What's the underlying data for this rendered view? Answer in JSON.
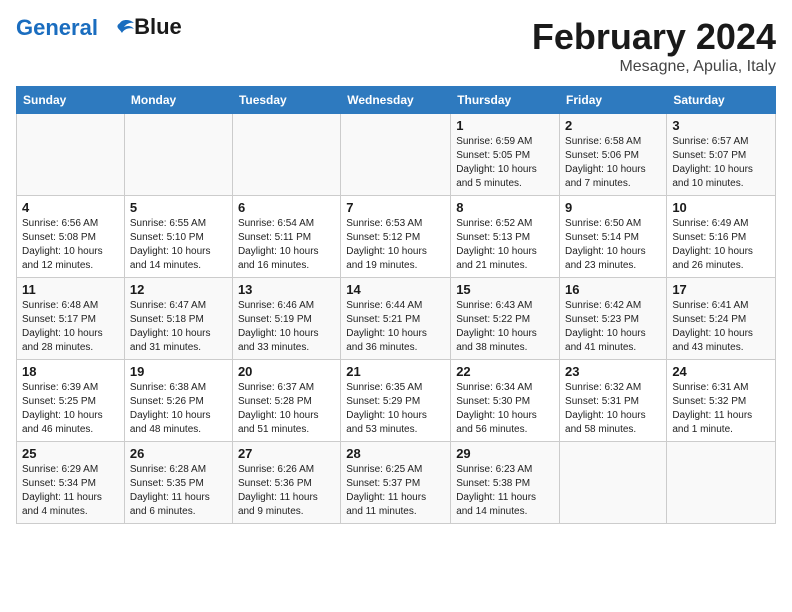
{
  "header": {
    "logo_line1": "General",
    "logo_line2": "Blue",
    "month_title": "February 2024",
    "subtitle": "Mesagne, Apulia, Italy"
  },
  "days_of_week": [
    "Sunday",
    "Monday",
    "Tuesday",
    "Wednesday",
    "Thursday",
    "Friday",
    "Saturday"
  ],
  "weeks": [
    [
      {
        "day": "",
        "detail": ""
      },
      {
        "day": "",
        "detail": ""
      },
      {
        "day": "",
        "detail": ""
      },
      {
        "day": "",
        "detail": ""
      },
      {
        "day": "1",
        "detail": "Sunrise: 6:59 AM\nSunset: 5:05 PM\nDaylight: 10 hours\nand 5 minutes."
      },
      {
        "day": "2",
        "detail": "Sunrise: 6:58 AM\nSunset: 5:06 PM\nDaylight: 10 hours\nand 7 minutes."
      },
      {
        "day": "3",
        "detail": "Sunrise: 6:57 AM\nSunset: 5:07 PM\nDaylight: 10 hours\nand 10 minutes."
      }
    ],
    [
      {
        "day": "4",
        "detail": "Sunrise: 6:56 AM\nSunset: 5:08 PM\nDaylight: 10 hours\nand 12 minutes."
      },
      {
        "day": "5",
        "detail": "Sunrise: 6:55 AM\nSunset: 5:10 PM\nDaylight: 10 hours\nand 14 minutes."
      },
      {
        "day": "6",
        "detail": "Sunrise: 6:54 AM\nSunset: 5:11 PM\nDaylight: 10 hours\nand 16 minutes."
      },
      {
        "day": "7",
        "detail": "Sunrise: 6:53 AM\nSunset: 5:12 PM\nDaylight: 10 hours\nand 19 minutes."
      },
      {
        "day": "8",
        "detail": "Sunrise: 6:52 AM\nSunset: 5:13 PM\nDaylight: 10 hours\nand 21 minutes."
      },
      {
        "day": "9",
        "detail": "Sunrise: 6:50 AM\nSunset: 5:14 PM\nDaylight: 10 hours\nand 23 minutes."
      },
      {
        "day": "10",
        "detail": "Sunrise: 6:49 AM\nSunset: 5:16 PM\nDaylight: 10 hours\nand 26 minutes."
      }
    ],
    [
      {
        "day": "11",
        "detail": "Sunrise: 6:48 AM\nSunset: 5:17 PM\nDaylight: 10 hours\nand 28 minutes."
      },
      {
        "day": "12",
        "detail": "Sunrise: 6:47 AM\nSunset: 5:18 PM\nDaylight: 10 hours\nand 31 minutes."
      },
      {
        "day": "13",
        "detail": "Sunrise: 6:46 AM\nSunset: 5:19 PM\nDaylight: 10 hours\nand 33 minutes."
      },
      {
        "day": "14",
        "detail": "Sunrise: 6:44 AM\nSunset: 5:21 PM\nDaylight: 10 hours\nand 36 minutes."
      },
      {
        "day": "15",
        "detail": "Sunrise: 6:43 AM\nSunset: 5:22 PM\nDaylight: 10 hours\nand 38 minutes."
      },
      {
        "day": "16",
        "detail": "Sunrise: 6:42 AM\nSunset: 5:23 PM\nDaylight: 10 hours\nand 41 minutes."
      },
      {
        "day": "17",
        "detail": "Sunrise: 6:41 AM\nSunset: 5:24 PM\nDaylight: 10 hours\nand 43 minutes."
      }
    ],
    [
      {
        "day": "18",
        "detail": "Sunrise: 6:39 AM\nSunset: 5:25 PM\nDaylight: 10 hours\nand 46 minutes."
      },
      {
        "day": "19",
        "detail": "Sunrise: 6:38 AM\nSunset: 5:26 PM\nDaylight: 10 hours\nand 48 minutes."
      },
      {
        "day": "20",
        "detail": "Sunrise: 6:37 AM\nSunset: 5:28 PM\nDaylight: 10 hours\nand 51 minutes."
      },
      {
        "day": "21",
        "detail": "Sunrise: 6:35 AM\nSunset: 5:29 PM\nDaylight: 10 hours\nand 53 minutes."
      },
      {
        "day": "22",
        "detail": "Sunrise: 6:34 AM\nSunset: 5:30 PM\nDaylight: 10 hours\nand 56 minutes."
      },
      {
        "day": "23",
        "detail": "Sunrise: 6:32 AM\nSunset: 5:31 PM\nDaylight: 10 hours\nand 58 minutes."
      },
      {
        "day": "24",
        "detail": "Sunrise: 6:31 AM\nSunset: 5:32 PM\nDaylight: 11 hours\nand 1 minute."
      }
    ],
    [
      {
        "day": "25",
        "detail": "Sunrise: 6:29 AM\nSunset: 5:34 PM\nDaylight: 11 hours\nand 4 minutes."
      },
      {
        "day": "26",
        "detail": "Sunrise: 6:28 AM\nSunset: 5:35 PM\nDaylight: 11 hours\nand 6 minutes."
      },
      {
        "day": "27",
        "detail": "Sunrise: 6:26 AM\nSunset: 5:36 PM\nDaylight: 11 hours\nand 9 minutes."
      },
      {
        "day": "28",
        "detail": "Sunrise: 6:25 AM\nSunset: 5:37 PM\nDaylight: 11 hours\nand 11 minutes."
      },
      {
        "day": "29",
        "detail": "Sunrise: 6:23 AM\nSunset: 5:38 PM\nDaylight: 11 hours\nand 14 minutes."
      },
      {
        "day": "",
        "detail": ""
      },
      {
        "day": "",
        "detail": ""
      }
    ]
  ]
}
